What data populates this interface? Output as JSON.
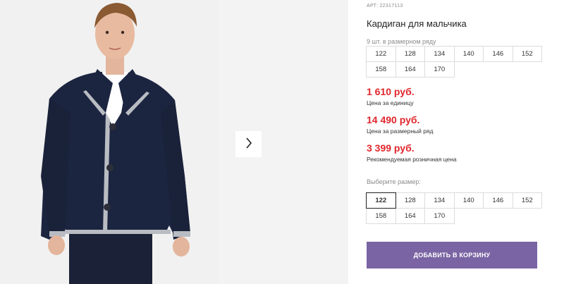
{
  "product": {
    "article_prefix": "АРТ:",
    "article_number": "22317113",
    "title": "Кардиган для мальчика",
    "size_range_note": "9 шт. в размерном ряду"
  },
  "size_range": [
    "122",
    "128",
    "134",
    "140",
    "146",
    "152",
    "158",
    "164",
    "170"
  ],
  "prices": {
    "unit_price": "1 610 руб.",
    "unit_label": "Цена за единицу",
    "range_price": "14 490 руб.",
    "range_label": "Цена за размерный ряд",
    "retail_price": "3 399 руб.",
    "retail_label": "Рекомендуемая розничная цена"
  },
  "size_selector": {
    "label": "Выберите размер:",
    "options": [
      "122",
      "128",
      "134",
      "140",
      "146",
      "152",
      "158",
      "164",
      "170"
    ],
    "selected": "122"
  },
  "cart": {
    "add_label": "ДОБАВИТЬ В КОРЗИНУ"
  },
  "colors": {
    "price_red": "#e0262c",
    "button_purple": "#7a64a3",
    "cardigan_navy": "#1c2540",
    "trim_grey": "#b9bcc2"
  },
  "icons": {
    "gallery_next": "chevron-right-icon"
  }
}
